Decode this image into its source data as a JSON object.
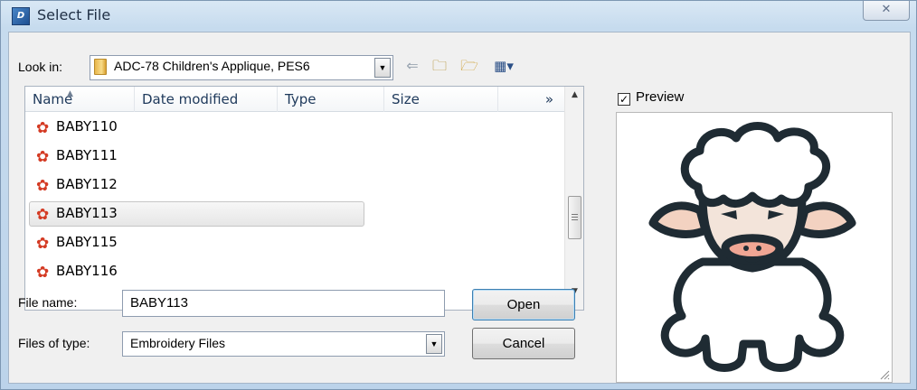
{
  "window": {
    "title": "Select File",
    "close_glyph": "✕"
  },
  "toolbar": {
    "look_in_label": "Look in:",
    "look_in_value": "ADC-78 Children's Applique, PES6",
    "icons": [
      "back-arrow-icon",
      "up-folder-icon",
      "new-folder-icon",
      "view-menu-icon"
    ]
  },
  "filelist": {
    "columns": [
      "Name",
      "Date modified",
      "Type",
      "Size"
    ],
    "more_columns_glyph": "»",
    "files": [
      {
        "name": "BABY110",
        "selected": false
      },
      {
        "name": "BABY111",
        "selected": false
      },
      {
        "name": "BABY112",
        "selected": false
      },
      {
        "name": "BABY113",
        "selected": true
      },
      {
        "name": "BABY115",
        "selected": false
      },
      {
        "name": "BABY116",
        "selected": false
      }
    ]
  },
  "form": {
    "file_name_label": "File name:",
    "file_name_value": "BABY113",
    "file_type_label": "Files of type:",
    "file_type_value": "Embroidery Files"
  },
  "buttons": {
    "open_label": "Open",
    "cancel_label": "Cancel"
  },
  "preview": {
    "label": "Preview",
    "checked": true,
    "check_glyph": "✓"
  },
  "colors": {
    "outline": "#1f2b33",
    "fleece": "#ffffff",
    "face": "#f3e4da",
    "nose": "#f0a694",
    "ear_inner": "#f3d2c1"
  }
}
